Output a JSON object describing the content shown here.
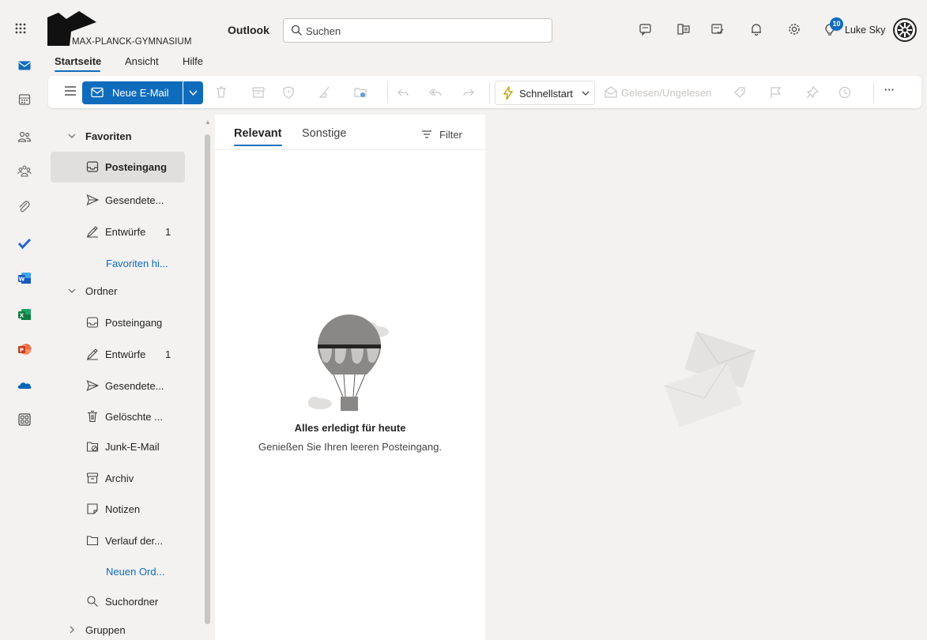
{
  "header": {
    "org_name": "MAX-PLANCK-GYMNASIUM",
    "app_title": "Outlook",
    "search_placeholder": "Suchen",
    "user_name": "Luke Sky",
    "notification_count": "10",
    "icons": [
      "waffle-icon",
      "chat-icon",
      "office-icon",
      "tasks-icon",
      "bell-icon",
      "gear-icon",
      "lightbulb-icon"
    ]
  },
  "ribbon": {
    "tabs": [
      {
        "label": "Startseite",
        "active": true
      },
      {
        "label": "Ansicht",
        "active": false
      },
      {
        "label": "Hilfe",
        "active": false
      }
    ],
    "new_mail_label": "Neue E-Mail",
    "quick_steps_label": "Schnellstart",
    "read_unread_label": "Gelesen/Ungelesen",
    "more_label": "···"
  },
  "folders": {
    "favorites_label": "Favoriten",
    "folders_label": "Ordner",
    "groups_label": "Gruppen",
    "favorites": [
      {
        "label": "Posteingang",
        "count": "",
        "icon": "inbox-icon",
        "selected": true
      },
      {
        "label": "Gesendete...",
        "count": "",
        "icon": "send-icon"
      },
      {
        "label": "Entwürfe",
        "count": "1",
        "icon": "drafts-icon"
      },
      {
        "label": "Favoriten hi...",
        "count": "",
        "icon": "",
        "link": true
      }
    ],
    "items": [
      {
        "label": "Posteingang",
        "count": "",
        "icon": "inbox-icon"
      },
      {
        "label": "Entwürfe",
        "count": "1",
        "icon": "drafts-icon"
      },
      {
        "label": "Gesendete...",
        "count": "",
        "icon": "send-icon"
      },
      {
        "label": "Gelöschte ...",
        "count": "",
        "icon": "trash-icon"
      },
      {
        "label": "Junk-E-Mail",
        "count": "",
        "icon": "junk-icon"
      },
      {
        "label": "Archiv",
        "count": "",
        "icon": "archive-icon"
      },
      {
        "label": "Notizen",
        "count": "",
        "icon": "notes-icon"
      },
      {
        "label": "Verlauf der...",
        "count": "",
        "icon": "folder-icon"
      },
      {
        "label": "Neuen Ord...",
        "count": "",
        "icon": "",
        "link": true
      },
      {
        "label": "Suchordner",
        "count": "",
        "icon": "search-icon"
      }
    ]
  },
  "message_list": {
    "tab_relevant": "Relevant",
    "tab_other": "Sonstige",
    "filter_label": "Filter",
    "empty_title": "Alles erledigt für heute",
    "empty_subtitle": "Genießen Sie Ihren leeren Posteingang."
  },
  "colors": {
    "accent": "#0f6cbd",
    "background": "#f3f2f1",
    "surface": "#ffffff"
  }
}
